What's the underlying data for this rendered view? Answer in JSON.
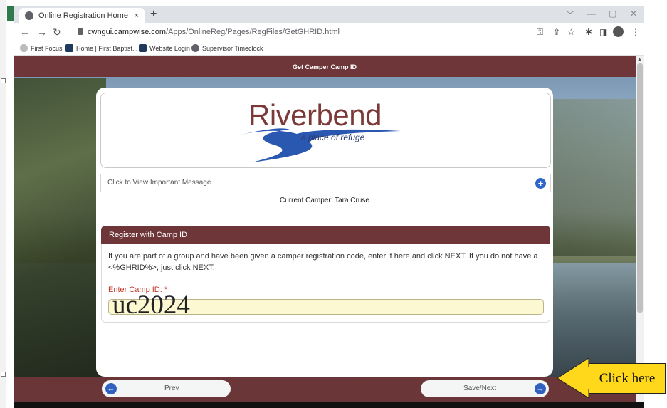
{
  "browser": {
    "tab_title": "Online Registration Home Page",
    "tab_close": "×",
    "new_tab": "+",
    "url_host": "cwngui.campwise.com",
    "url_path": "/Apps/OnlineReg/Pages/RegFiles/GetGHRID.html",
    "window_controls": [
      "﹀",
      "—",
      "▢",
      "✕"
    ],
    "bookmarks": [
      "First Focus",
      "Home | First Baptist...",
      "Website Login",
      "Supervisor Timeclock"
    ]
  },
  "page": {
    "header_title": "Get Camper Camp ID",
    "logo_text": "Riverbend",
    "logo_tagline": "a place of refuge",
    "important_message": "Click to View Important Message",
    "plus_icon": "+",
    "current_camper": "Current Camper: Tara Cruse",
    "section_title": "Register with Camp ID",
    "section_text": "If you are part of a group and have been given a camper registration code, enter it here and click NEXT. If you do not have a <%GHRID%>, just click NEXT.",
    "field_label": "Enter Camp ID: *",
    "field_value": "uc2024",
    "prev_label": "Prev",
    "next_label": "Save/Next",
    "prev_icon": "←",
    "next_icon": "→"
  },
  "annotation": {
    "callout_text": "Click here"
  },
  "colors": {
    "brand_maroon": "#6e3638",
    "accent_blue": "#2f64c8",
    "input_yellow": "#fcf8d2",
    "callout_yellow": "#ffd81c"
  }
}
